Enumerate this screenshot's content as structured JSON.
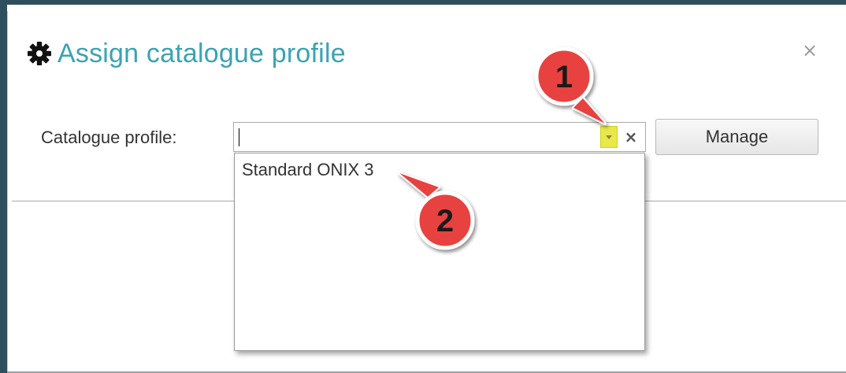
{
  "dialog": {
    "title": "Assign catalogue profile",
    "title_icon": "gear-icon",
    "close_label": "×"
  },
  "form": {
    "catalogue_profile_label": "Catalogue profile:",
    "catalogue_profile_value": "",
    "clear_label": "×",
    "manage_label": "Manage"
  },
  "dropdown": {
    "items": [
      "Standard ONIX 3"
    ]
  },
  "callouts": {
    "first": "1",
    "second": "2"
  },
  "colors": {
    "title": "#3aa3b2",
    "window_border": "#2f4f5e",
    "dropdown_button_highlight": "#e8e84a",
    "callout_fill": "#e8433f"
  }
}
